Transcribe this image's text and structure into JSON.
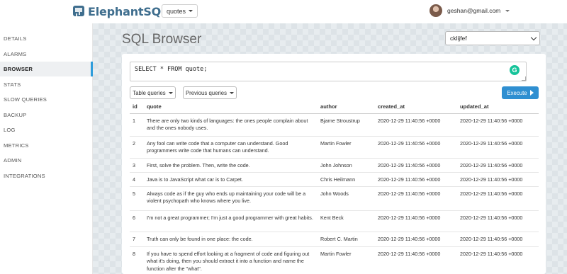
{
  "header": {
    "logo_text": "ElephantSQL",
    "instance_select": "quotes",
    "user_email": "geshan@gmail.com"
  },
  "sidebar": {
    "items": [
      {
        "label": "DETAILS"
      },
      {
        "label": "ALARMS"
      },
      {
        "label": "BROWSER",
        "active": true
      },
      {
        "label": "STATS"
      },
      {
        "label": "SLOW QUERIES"
      },
      {
        "label": "BACKUP"
      },
      {
        "label": "LOG"
      },
      {
        "label": "METRICS"
      },
      {
        "label": "ADMIN"
      },
      {
        "label": "INTEGRATIONS"
      }
    ]
  },
  "main": {
    "title": "SQL Browser",
    "database_select": "cklijfef",
    "query": "SELECT * FROM quote;",
    "table_queries_label": "Table queries",
    "previous_queries_label": "Previous queries",
    "execute_label": "Execute"
  },
  "results": {
    "columns": [
      "id",
      "quote",
      "author",
      "created_at",
      "updated_at"
    ],
    "rows": [
      [
        "1",
        "There are only two kinds of languages: the ones people complain about and the ones nobody uses.",
        "Bjarne Stroustrup",
        "2020-12-29 11:40:56 +0000",
        "2020-12-29 11:40:56 +0000"
      ],
      [
        "2",
        "Any fool can write code that a computer can understand. Good programmers write code that humans can understand.",
        "Martin Fowler",
        "2020-12-29 11:40:56 +0000",
        "2020-12-29 11:40:56 +0000"
      ],
      [
        "3",
        "First, solve the problem. Then, write the code.",
        "John Johnson",
        "2020-12-29 11:40:56 +0000",
        "2020-12-29 11:40:56 +0000"
      ],
      [
        "4",
        "Java is to JavaScript what car is to Carpet.",
        "Chris Heilmann",
        "2020-12-29 11:40:56 +0000",
        "2020-12-29 11:40:56 +0000"
      ],
      [
        "5",
        "Always code as if the guy who ends up maintaining your code will be a violent psychopath who knows where you live.",
        "John Woods",
        "2020-12-29 11:40:56 +0000",
        "2020-12-29 11:40:56 +0000"
      ],
      [
        "6",
        "I'm not a great programmer; I'm just a good programmer with great habits.",
        "Kent Beck",
        "2020-12-29 11:40:56 +0000",
        "2020-12-29 11:40:56 +0000"
      ],
      [
        "7",
        "Truth can only be found in one place: the code.",
        "Robert C. Martin",
        "2020-12-29 11:40:56 +0000",
        "2020-12-29 11:40:56 +0000"
      ],
      [
        "8",
        "If you have to spend effort looking at a fragment of code and figuring out what it's doing, then you should extract it into a function and name the function after the \"what\".",
        "Martin Fowler",
        "2020-12-29 11:40:56 +0000",
        "2020-12-29 11:40:56 +0000"
      ]
    ]
  },
  "colors": {
    "brand": "#3f6e8e",
    "accent": "#2f8fd1",
    "active_indicator": "#2d9cdb",
    "grammarly": "#15c39a"
  },
  "icons": [
    "elephant-logo-icon",
    "caret-down-icon",
    "chevron-down-icon",
    "grammarly-icon",
    "play-icon",
    "avatar"
  ]
}
